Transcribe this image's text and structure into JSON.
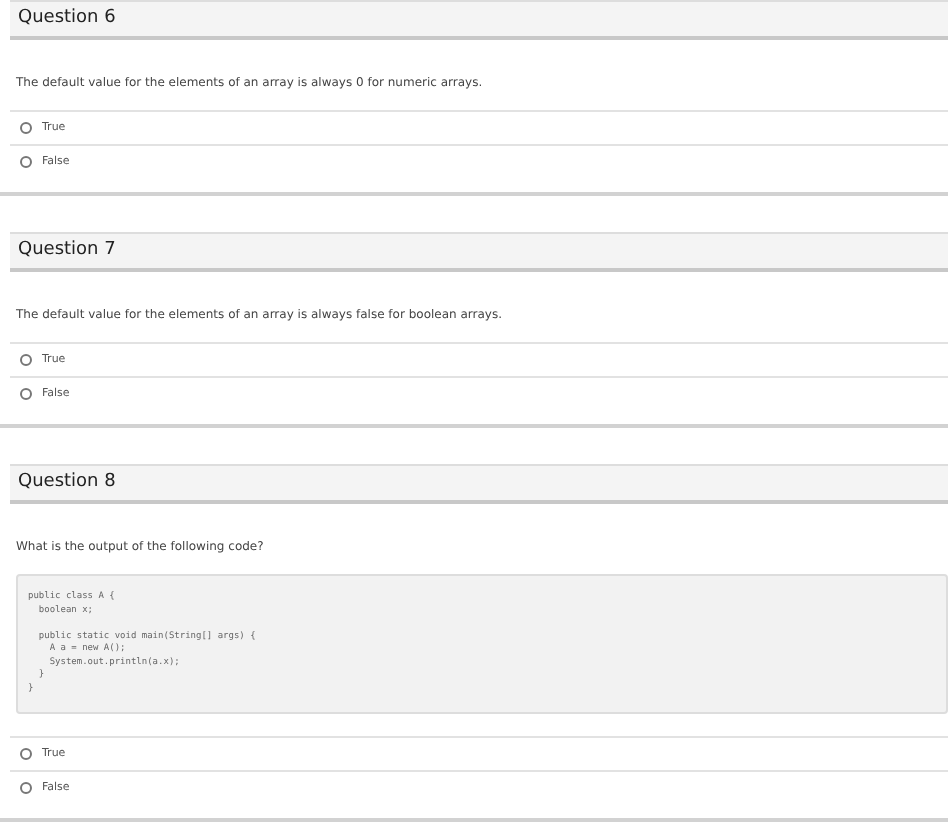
{
  "questions": [
    {
      "title": "Question 6",
      "prompt": "The default value for the elements of an array is always 0 for numeric arrays.",
      "options": [
        {
          "label": "True",
          "selected": false
        },
        {
          "label": "False",
          "selected": false
        }
      ]
    },
    {
      "title": "Question 7",
      "prompt": "The default value for the elements of an array is always false for boolean arrays.",
      "options": [
        {
          "label": "True",
          "selected": false
        },
        {
          "label": "False",
          "selected": false
        }
      ]
    },
    {
      "title": "Question 8",
      "prompt": "What is the output of the following code?",
      "code_groups": [
        [
          "public class A {",
          "  boolean x;"
        ],
        [
          "  public static void main(String[] args) {",
          "    A a = new A();",
          "    System.out.println(a.x);",
          "  }",
          "}"
        ]
      ],
      "options": [
        {
          "label": "True",
          "selected": false
        },
        {
          "label": "False",
          "selected": false
        }
      ]
    }
  ]
}
